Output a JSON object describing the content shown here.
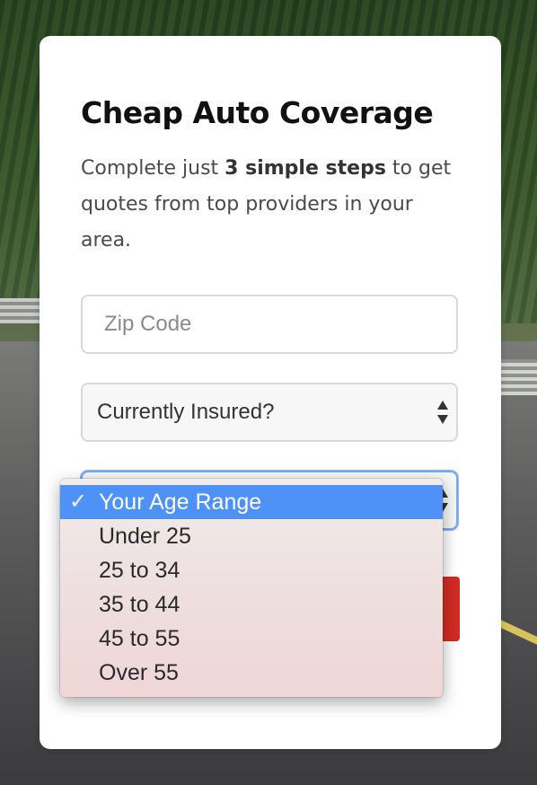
{
  "form": {
    "title": "Cheap Auto Coverage",
    "subtitle_pre": "Complete just ",
    "subtitle_bold": "3 simple steps",
    "subtitle_post": " to get quotes from top providers in your area.",
    "zip_placeholder": "Zip Code",
    "insured_value": "Currently Insured?"
  },
  "age_dropdown": {
    "selected_index": 0,
    "check_glyph": "✓",
    "options": [
      "Your Age Range",
      "Under 25",
      "25 to 34",
      "35 to 44",
      "45 to 55",
      "Over 55"
    ]
  },
  "colors": {
    "submit_red": "#d22c22",
    "selected_blue": "#4e92f7",
    "focus_blue": "#7aa9f0"
  },
  "icons": {
    "select_arrows": "updown-arrows-icon",
    "checkmark": "checkmark-icon"
  }
}
